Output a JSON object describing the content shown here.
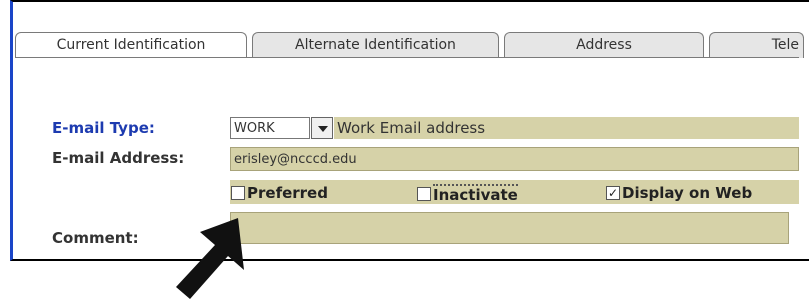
{
  "tabs": [
    {
      "label": "Current Identification"
    },
    {
      "label": "Alternate Identification"
    },
    {
      "label": "Address"
    },
    {
      "label": "Tele"
    }
  ],
  "form": {
    "email_type_label": "E-mail Type:",
    "email_type_code": "WORK",
    "email_type_desc": "Work Email address",
    "email_address_label": "E-mail Address:",
    "email_address_value": "erisley@ncccd.edu",
    "comment_label": "Comment:",
    "comment_value": ""
  },
  "checkboxes": [
    {
      "label": "Preferred",
      "checked": false
    },
    {
      "label": "Inactivate",
      "checked": false
    },
    {
      "label": "Display on Web",
      "checked": true
    }
  ],
  "colors": {
    "field_bg": "#d6d2a8",
    "label_blue": "#1d3bb0",
    "window_border": "#1a45c8"
  }
}
